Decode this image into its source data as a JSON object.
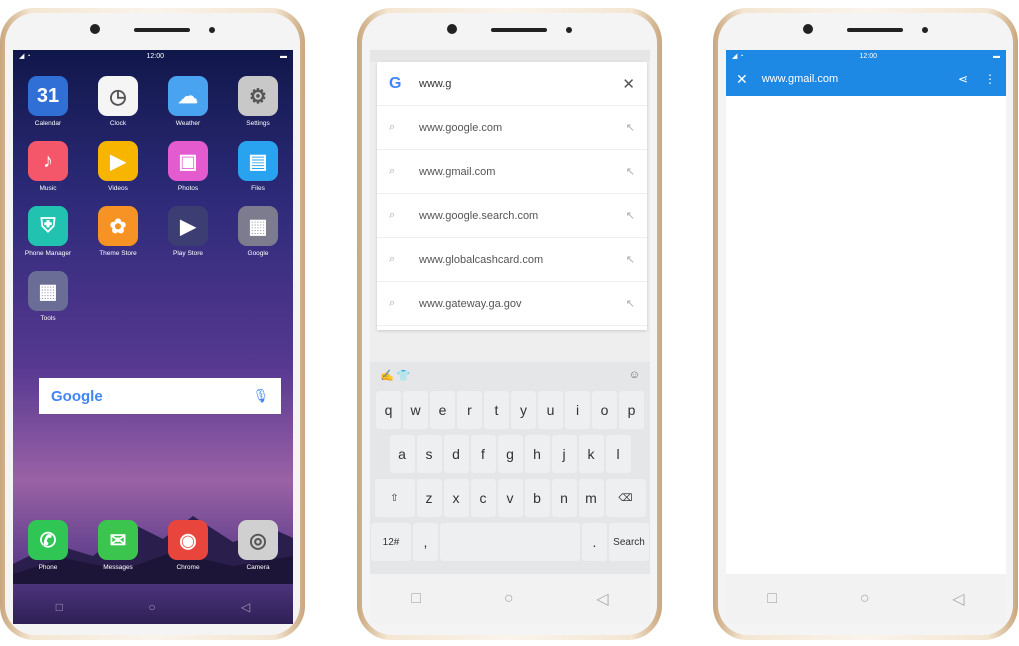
{
  "phone1": {
    "status_time": "12:00",
    "apps": [
      {
        "label": "Calendar",
        "glyph": "31",
        "color": "#2f6fd6",
        "icon": "calendar-icon"
      },
      {
        "label": "Clock",
        "glyph": "◷",
        "color": "#f5f5f5",
        "icon": "clock-icon"
      },
      {
        "label": "Weather",
        "glyph": "☁",
        "color": "#4aa3f0",
        "icon": "weather-icon"
      },
      {
        "label": "Settings",
        "glyph": "⚙",
        "color": "#c8c8c8",
        "icon": "gear-icon"
      },
      {
        "label": "Music",
        "glyph": "♪",
        "color": "#f4566a",
        "icon": "music-icon"
      },
      {
        "label": "Videos",
        "glyph": "▶",
        "color": "#f7b500",
        "icon": "video-icon"
      },
      {
        "label": "Photos",
        "glyph": "▣",
        "color": "#e45bd0",
        "icon": "photos-icon"
      },
      {
        "label": "Files",
        "glyph": "▤",
        "color": "#29a3ef",
        "icon": "folder-icon"
      },
      {
        "label": "Phone Manager",
        "glyph": "⛨",
        "color": "#21c3b0",
        "icon": "shield-icon"
      },
      {
        "label": "Theme Store",
        "glyph": "✿",
        "color": "#f79224",
        "icon": "palette-icon"
      },
      {
        "label": "Play Store",
        "glyph": "▶",
        "color": "#3b3d73",
        "icon": "play-store-icon"
      },
      {
        "label": "Google",
        "glyph": "▦",
        "color": "#7c7c8e",
        "icon": "folder-grid-icon"
      },
      {
        "label": "Tools",
        "glyph": "▦",
        "color": "#6a6d96",
        "icon": "folder-grid-icon"
      }
    ],
    "google_logo": "Google",
    "dock": [
      {
        "label": "Phone",
        "glyph": "✆",
        "color": "#2fc656",
        "icon": "phone-icon"
      },
      {
        "label": "Messages",
        "glyph": "✉",
        "color": "#3bc54f",
        "icon": "message-icon"
      },
      {
        "label": "Chrome",
        "glyph": "◉",
        "color": "#e8453c",
        "icon": "chrome-icon"
      },
      {
        "label": "Camera",
        "glyph": "◎",
        "color": "#d0d0d0",
        "icon": "camera-icon"
      }
    ]
  },
  "phone2": {
    "query": "www.g",
    "suggestions": [
      "www.google.com",
      "www.gmail.com",
      "www.google.search.com",
      "www.globalcashcard.com",
      "www.gateway.ga.gov"
    ],
    "keys_row1": [
      "q",
      "w",
      "e",
      "r",
      "t",
      "y",
      "u",
      "i",
      "o",
      "p"
    ],
    "keys_row2": [
      "a",
      "s",
      "d",
      "f",
      "g",
      "h",
      "j",
      "k",
      "l"
    ],
    "keys_row3": [
      "z",
      "x",
      "c",
      "v",
      "b",
      "n",
      "m"
    ],
    "key_numbers": "12#",
    "key_search": "Search"
  },
  "phone3": {
    "status_time": "12:00",
    "url": "www.gmail.com"
  }
}
